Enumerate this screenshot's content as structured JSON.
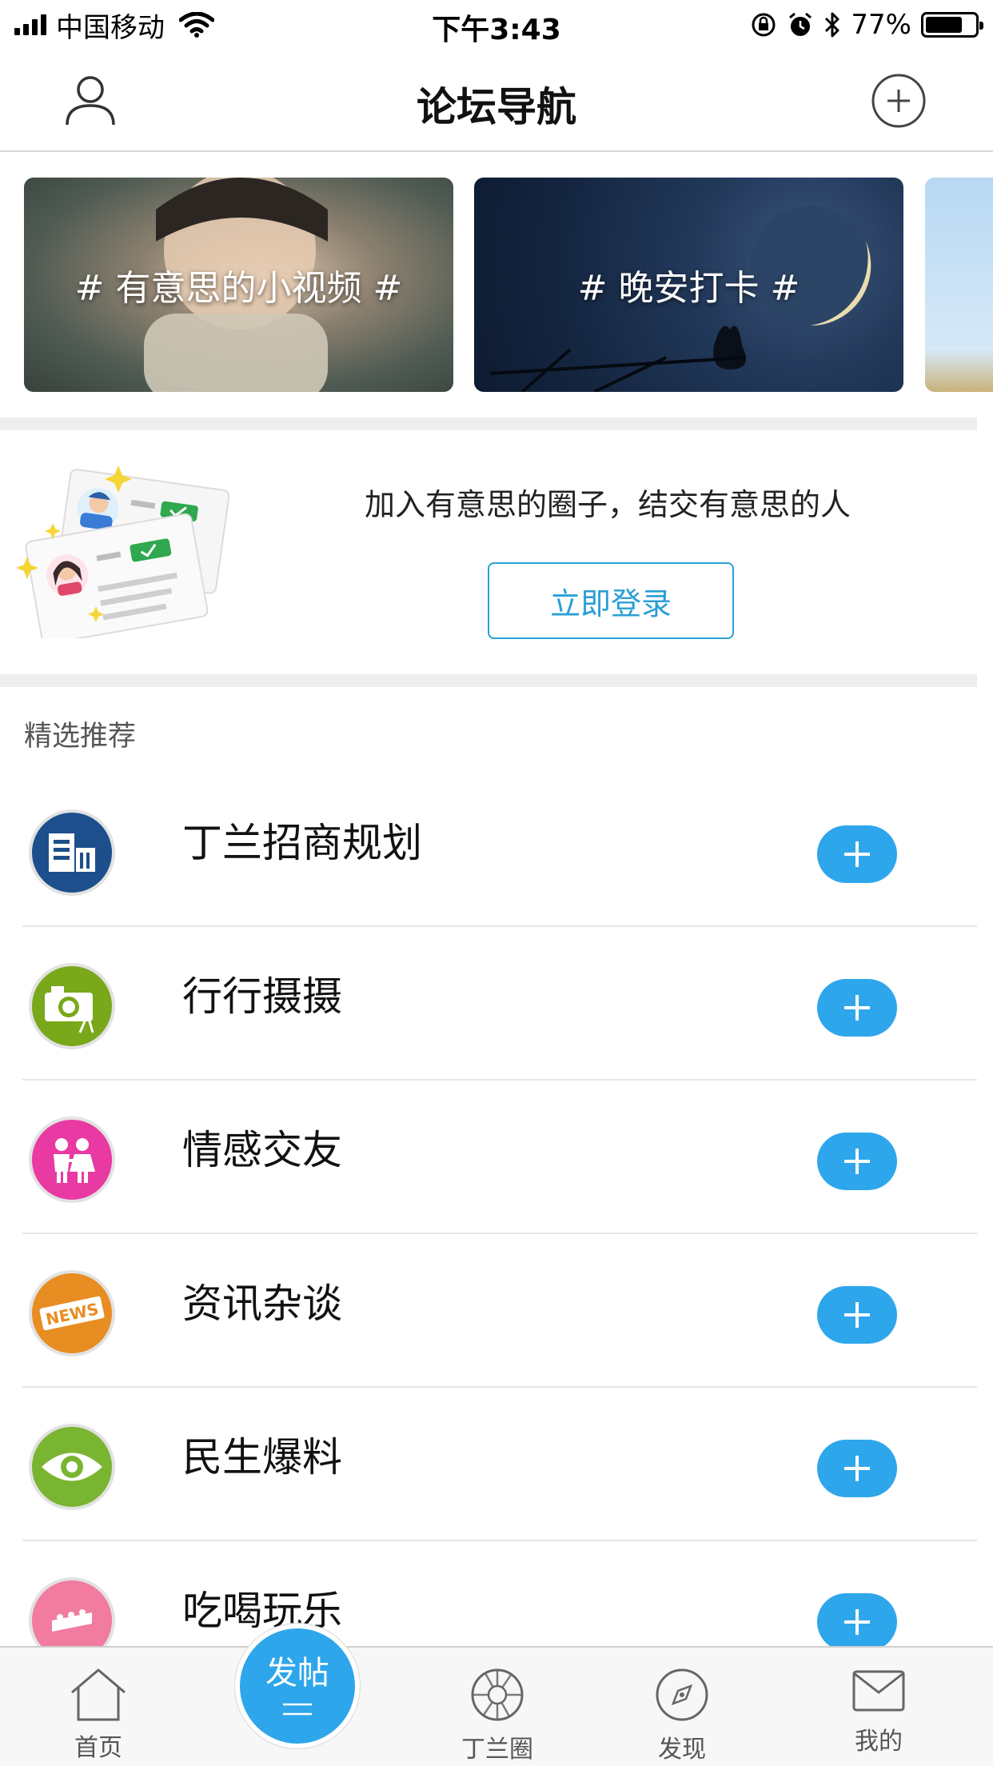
{
  "status_bar": {
    "carrier": "中国移动",
    "time": "下午3:43",
    "battery": "77%",
    "battery_level": 0.77
  },
  "nav": {
    "title": "论坛导航",
    "left_icon": "user-icon",
    "right_icon": "plus-circle-icon"
  },
  "banners": [
    {
      "label": "# 有意思的小视频 #"
    },
    {
      "label": "# 晚安打卡 #"
    },
    {
      "label": ""
    }
  ],
  "promo": {
    "text": "加入有意思的圈子，结交有意思的人",
    "login_label": "立即登录"
  },
  "section": {
    "title": "精选推荐"
  },
  "forums": [
    {
      "name": "丁兰招商规划",
      "icon": "building-icon",
      "color": "#1d4f8c"
    },
    {
      "name": "行行摄摄",
      "icon": "camera-icon",
      "color": "#79a81a"
    },
    {
      "name": "情感交友",
      "icon": "couple-icon",
      "color": "#e83aa2"
    },
    {
      "name": "资讯杂谈",
      "icon": "news-icon",
      "color": "#e88d22"
    },
    {
      "name": "民生爆料",
      "icon": "eye-icon",
      "color": "#79b530"
    },
    {
      "name": "吃喝玩乐",
      "icon": "cake-icon",
      "color": "#f27ba0"
    }
  ],
  "tab_bar": {
    "home": "首页",
    "post": "发帖",
    "circle": "丁兰圈",
    "discover": "发现",
    "mine": "我的"
  },
  "colors": {
    "accent": "#2ea6ec",
    "login_border": "#29a0d8"
  }
}
